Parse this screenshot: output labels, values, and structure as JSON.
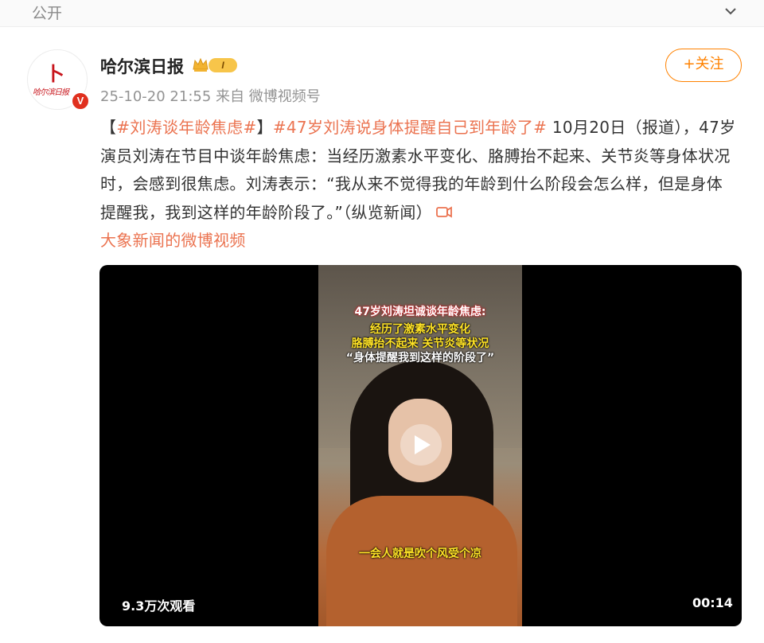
{
  "header": {
    "visibility": "公开",
    "collapse_icon": "chevron-down-icon"
  },
  "author": {
    "name": "哈尔滨日报",
    "avatar_logo": "卜",
    "avatar_text": "哈尔滨日报",
    "verified_badge": "V",
    "level_badge": "I",
    "crown_icon": "crown-icon"
  },
  "meta": {
    "time": "25-10-20 21:55",
    "source": "来自 微博视频号"
  },
  "follow_button": {
    "label": "+关注"
  },
  "post": {
    "bracket_open": "【",
    "hashtag1": "#刘涛谈年龄焦虑#",
    "bracket_close": "】",
    "hashtag2": "#47岁刘涛说身体提醒自己到年龄了#",
    "body": " 10月20日（报道），47岁演员刘涛在节目中谈年龄焦虑：当经历激素水平变化、胳膊抬不起来、关节炎等身体状况时，会感到很焦虑。刘涛表示：“我从来不觉得我的年龄到什么阶段会怎么样，但是身体提醒我，我到这样的年龄阶段了。”（纵览新闻）",
    "video_link": "大象新闻的微博视频",
    "video_link_icon": "video-icon"
  },
  "video": {
    "caption_title": "47岁刘涛坦诚谈年龄焦虑:",
    "caption_line1": "经历了激素水平变化",
    "caption_line2": "胳膊抬不起来 关节炎等状况",
    "caption_quote": "“身体提醒我到这样的阶段了”",
    "subtitle": "一会人就是吹个风受个凉",
    "views": "9.3万次观看",
    "duration": "00:14",
    "play_icon": "play-icon"
  },
  "colors": {
    "accent": "#ff8200",
    "hashtag": "#eb7350",
    "text": "#333333",
    "meta": "#939393"
  }
}
